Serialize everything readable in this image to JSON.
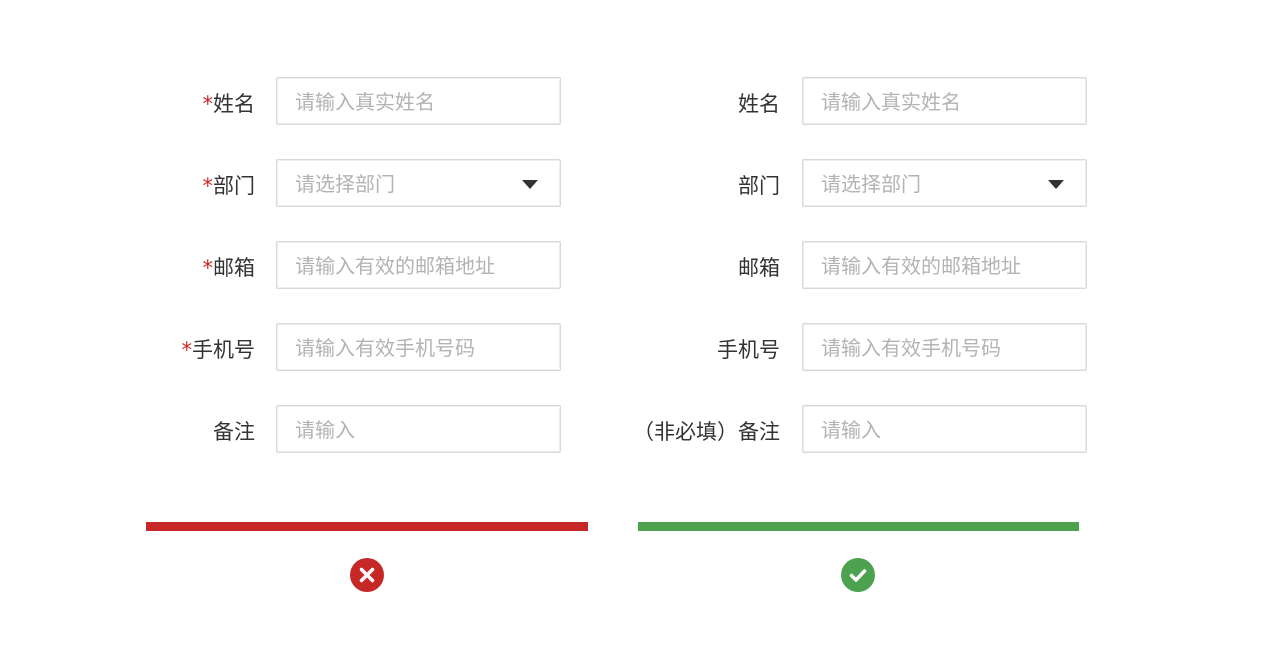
{
  "wrong_example": {
    "fields": [
      {
        "required_mark": "*",
        "label": "姓名",
        "placeholder": "请输入真实姓名",
        "type": "text"
      },
      {
        "required_mark": "*",
        "label": "部门",
        "placeholder": "请选择部门",
        "type": "select"
      },
      {
        "required_mark": "*",
        "label": "邮箱",
        "placeholder": "请输入有效的邮箱地址",
        "type": "text"
      },
      {
        "required_mark": "*",
        "label": "手机号",
        "placeholder": "请输入有效手机号码",
        "type": "text"
      },
      {
        "required_mark": "",
        "label": "备注",
        "placeholder": "请输入",
        "type": "text"
      }
    ],
    "indicator_color": "#c62828",
    "indicator_icon": "close-icon"
  },
  "right_example": {
    "fields": [
      {
        "label": "姓名",
        "placeholder": "请输入真实姓名",
        "type": "text"
      },
      {
        "label": "部门",
        "placeholder": "请选择部门",
        "type": "select"
      },
      {
        "label": "邮箱",
        "placeholder": "请输入有效的邮箱地址",
        "type": "text"
      },
      {
        "label": "手机号",
        "placeholder": "请输入有效手机号码",
        "type": "text"
      },
      {
        "label": "（非必填）备注",
        "placeholder": "请输入",
        "type": "text"
      }
    ],
    "indicator_color": "#4ca24f",
    "indicator_icon": "check-icon"
  }
}
